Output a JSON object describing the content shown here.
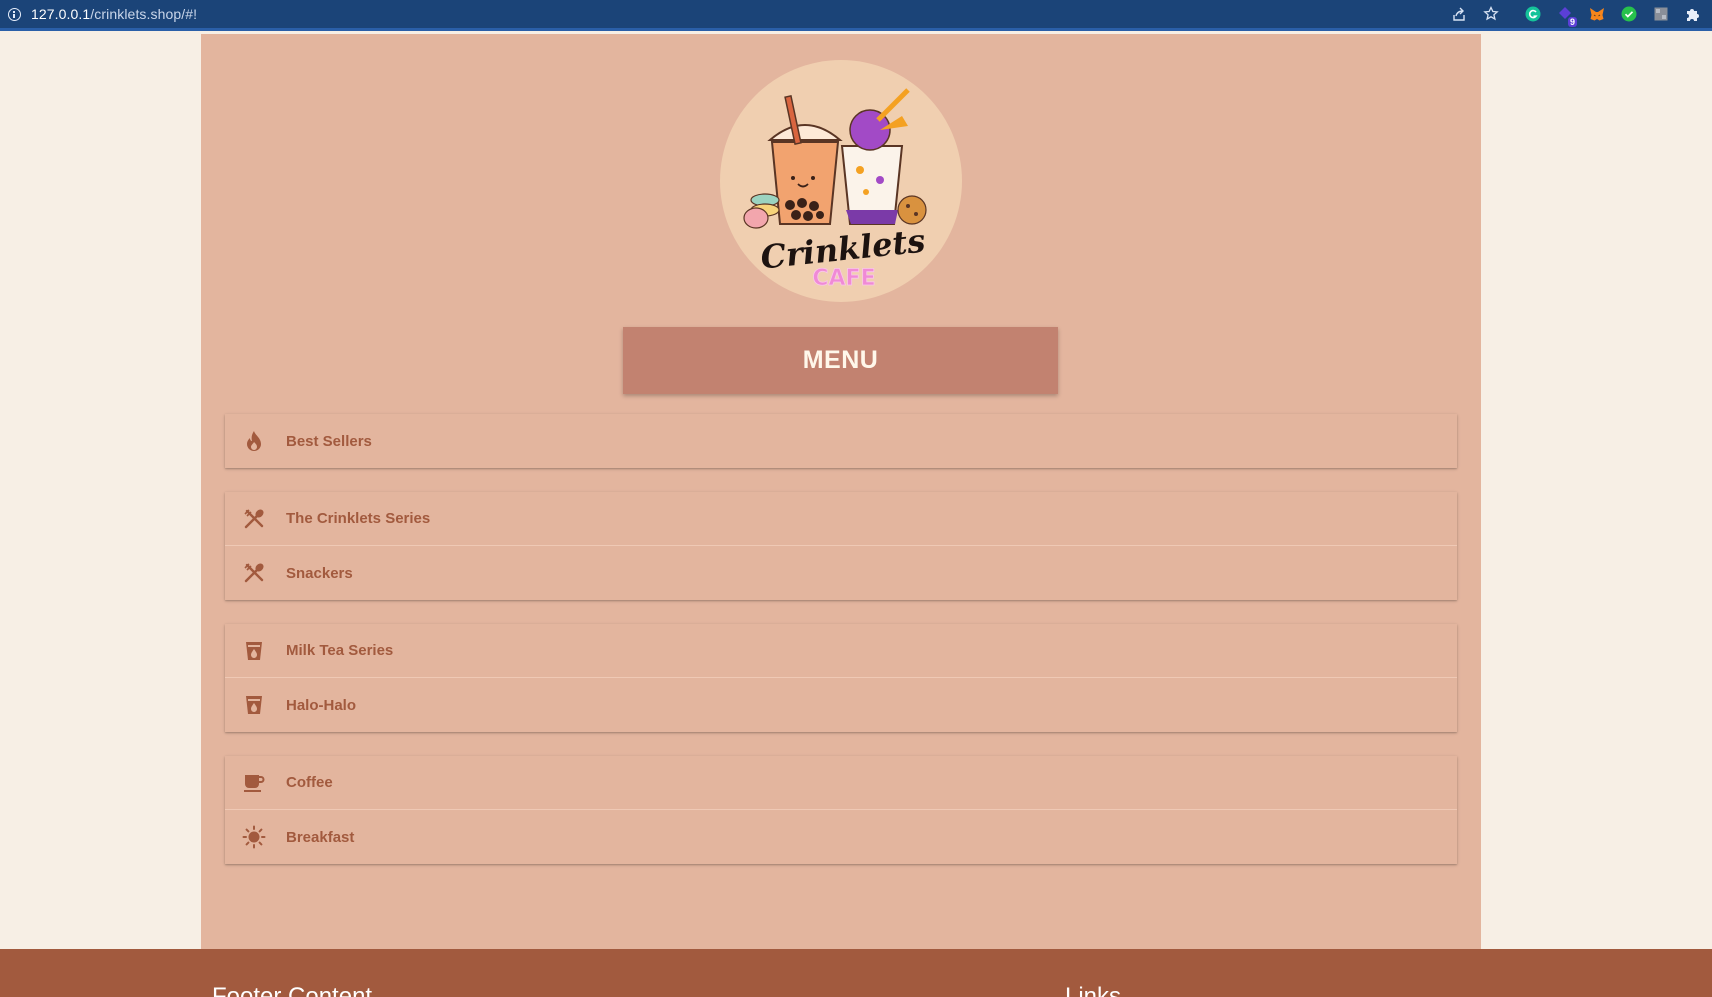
{
  "browser": {
    "url_host": "127.0.0.1",
    "url_path": "/crinklets.shop/#!",
    "extension_badge": "9"
  },
  "brand": {
    "script_name": "Crinklets",
    "sub_name": "CAFE"
  },
  "menu": {
    "title": "MENU",
    "groups": [
      {
        "items": [
          {
            "label": "Best Sellers",
            "icon": "fire-icon"
          }
        ]
      },
      {
        "items": [
          {
            "label": "The Crinklets Series",
            "icon": "utensils-icon"
          },
          {
            "label": "Snackers",
            "icon": "utensils-icon"
          }
        ]
      },
      {
        "items": [
          {
            "label": "Milk Tea Series",
            "icon": "drink-cup-icon"
          },
          {
            "label": "Halo-Halo",
            "icon": "drink-cup-icon"
          }
        ]
      },
      {
        "items": [
          {
            "label": "Coffee",
            "icon": "coffee-mug-icon"
          },
          {
            "label": "Breakfast",
            "icon": "sun-icon"
          }
        ]
      }
    ]
  },
  "footer": {
    "content_heading": "Footer Content",
    "links_heading": "Links"
  },
  "colors": {
    "page_bg": "#f7efe5",
    "main_bg": "#e3b59e",
    "menu_header_bg": "#c28270",
    "item_text": "#a25a3e",
    "footer_bg": "#a25a3e",
    "browser_bar": "#1b4478"
  }
}
